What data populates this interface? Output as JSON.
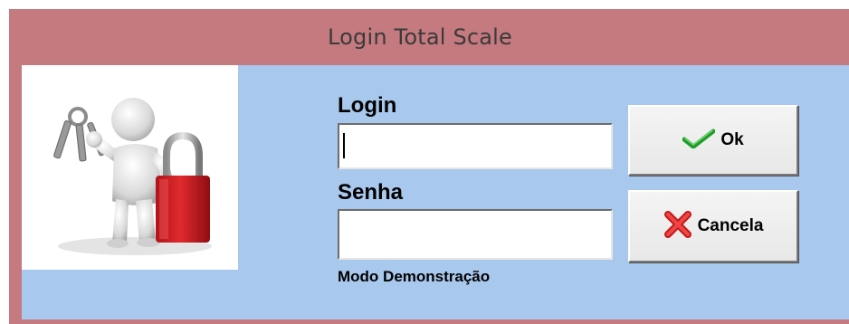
{
  "window": {
    "title": "Login Total Scale",
    "titlebar_color": "#c47a7f",
    "client_color": "#a9c8ed"
  },
  "form": {
    "login_label": "Login",
    "login_value": "",
    "password_label": "Senha",
    "password_value": "",
    "mode_text": "Modo Demonstração"
  },
  "buttons": {
    "ok_label": "Ok",
    "ok_icon": "checkmark-icon",
    "cancel_label": "Cancela",
    "cancel_icon": "red-x-icon"
  },
  "illustration": {
    "icon": "person-with-keys-and-padlock"
  }
}
